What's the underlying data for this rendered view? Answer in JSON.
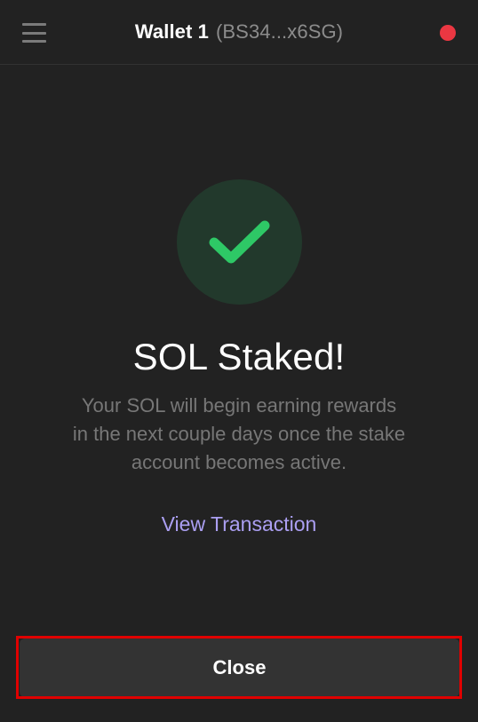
{
  "header": {
    "wallet_name": "Wallet 1",
    "wallet_address": "(BS34...x6SG)",
    "menu_icon": "hamburger-menu-icon",
    "status_color": "#eb3742"
  },
  "success": {
    "icon": "checkmark-icon",
    "icon_color": "#2ec866",
    "title": "SOL Staked!",
    "description_lines": [
      "Your SOL will begin earning rewards",
      "in the next couple days once the stake",
      "account becomes active."
    ],
    "link_label": "View Transaction"
  },
  "footer": {
    "close_label": "Close"
  },
  "colors": {
    "background": "#222222",
    "accent": "#ab9ff2",
    "button_bg": "#333333",
    "highlight": "#e00000"
  }
}
